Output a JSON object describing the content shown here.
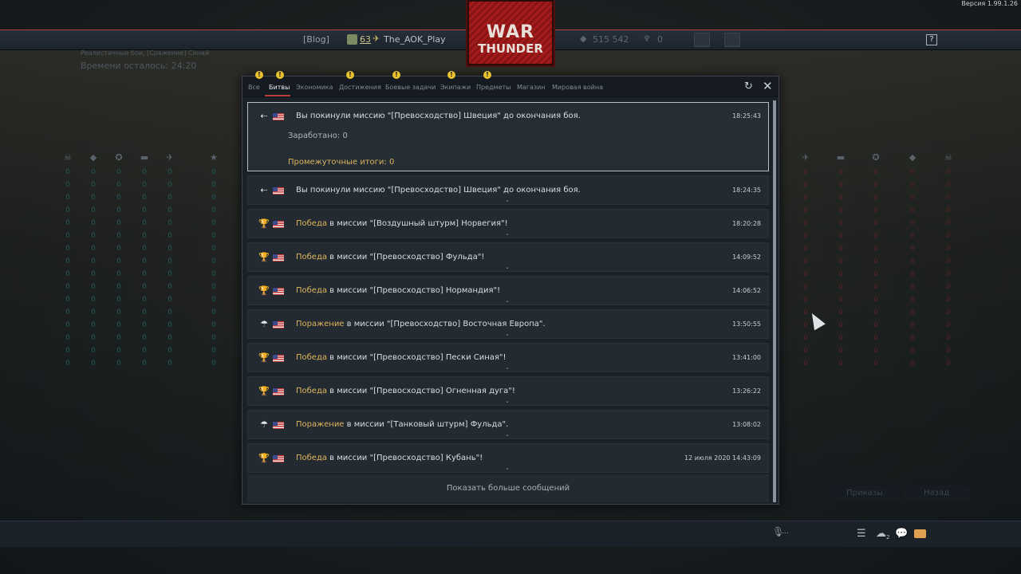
{
  "version": "Версия 1.99.1.26",
  "topbar": {
    "blog": "[Blog]",
    "level": "63",
    "nickname": "The_AOK_Play",
    "currency1": "515 542",
    "currency2": "0",
    "help": "?"
  },
  "logo": {
    "line1": "WAR",
    "line2": "THUNDER"
  },
  "mission": {
    "info": "Реалистичные бои, [Сражение] Синай",
    "time_left": "Времени осталось: 24:20"
  },
  "tabs": [
    {
      "label": "Все",
      "badge": "!"
    },
    {
      "label": "Битвы",
      "badge": "!",
      "active": true
    },
    {
      "label": "Экономика",
      "badge": ""
    },
    {
      "label": "Достижения",
      "badge": "!"
    },
    {
      "label": "Боевые задачи",
      "badge": "!"
    },
    {
      "label": "Экипажи",
      "badge": "!"
    },
    {
      "label": "Предметы",
      "badge": "!"
    },
    {
      "label": "Магазин",
      "badge": ""
    },
    {
      "label": "Мировая война",
      "badge": ""
    }
  ],
  "messages": [
    {
      "icon": "leave-icon",
      "text": "Вы покинули миссию \"[Превосходство] Швеция\" до окончания боя.",
      "time": "18:25:43",
      "earned": "Заработано: 0",
      "subtotal": "Промежуточные итоги: 0"
    },
    {
      "icon": "leave-icon",
      "prefix": "",
      "text": "Вы покинули миссию \"[Превосходство] Швеция\" до окончания боя.",
      "time": "18:24:35"
    },
    {
      "icon": "trophy-icon",
      "prefix": "Победа",
      "text": " в миссии \"[Воздушный штурм] Норвегия\"!",
      "time": "18:20:28"
    },
    {
      "icon": "trophy-icon",
      "prefix": "Победа",
      "text": " в миссии \"[Превосходство] Фульда\"!",
      "time": "14:09:52"
    },
    {
      "icon": "trophy-icon",
      "prefix": "Победа",
      "text": " в миссии \"[Превосходство] Нормандия\"!",
      "time": "14:06:52"
    },
    {
      "icon": "parachute-icon",
      "prefix": "Поражение",
      "text": " в миссии \"[Превосходство] Восточная Европа\".",
      "time": "13:50:55"
    },
    {
      "icon": "trophy-icon",
      "prefix": "Победа",
      "text": " в миссии \"[Превосходство] Пески Синая\"!",
      "time": "13:41:00"
    },
    {
      "icon": "trophy-icon",
      "prefix": "Победа",
      "text": " в миссии \"[Превосходство] Огненная дуга\"!",
      "time": "13:26:22"
    },
    {
      "icon": "parachute-icon",
      "prefix": "Поражение",
      "text": " в миссии \"[Танковый штурм] Фульда\".",
      "time": "13:08:02"
    },
    {
      "icon": "trophy-icon",
      "prefix": "Победа",
      "text": " в миссии \"[Превосходство] Кубань\"!",
      "time": "12 июля 2020 14:43:09"
    }
  ],
  "show_more": "Показать больше сообщений",
  "bottom": {
    "orders": "Приказы",
    "back": "Назад",
    "mic_dots": "...",
    "squad_count": "2"
  },
  "scores": {
    "left_values": [
      "0",
      "0",
      "0",
      "0",
      "0",
      "0",
      "0",
      "0",
      "0",
      "0",
      "0",
      "0",
      "0",
      "0",
      "0",
      "0"
    ],
    "right_values": [
      "0",
      "0",
      "0",
      "0",
      "0",
      "0",
      "0",
      "0",
      "0",
      "0",
      "0",
      "0",
      "0",
      "0",
      "0",
      "0"
    ]
  },
  "colors": {
    "accent": "#b84040",
    "victory": "#dfb65a",
    "badge": "#e8c12f"
  }
}
